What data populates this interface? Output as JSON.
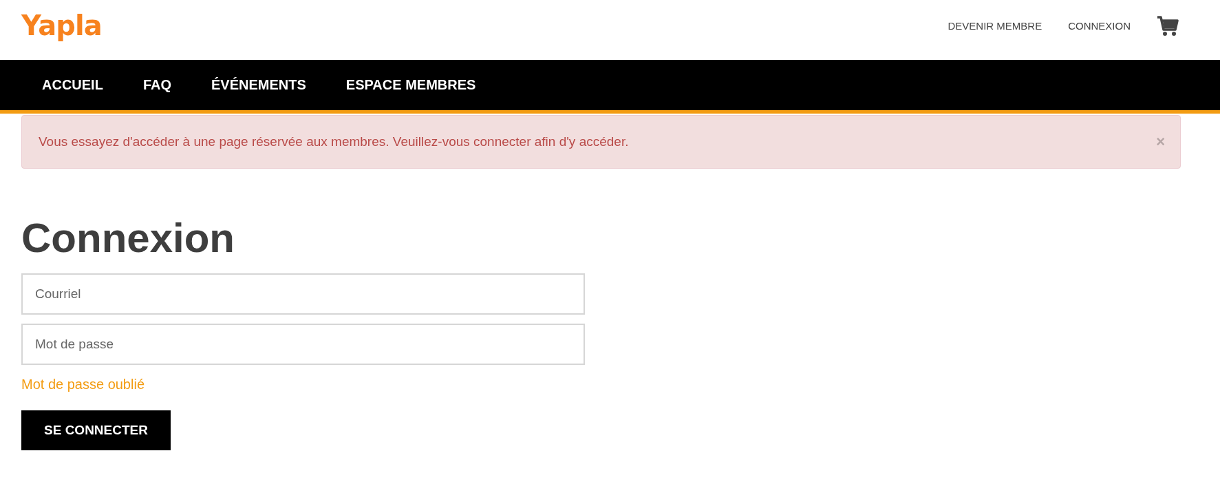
{
  "logo": "Yapla",
  "top_links": [
    "DEVENIR MEMBRE",
    "CONNEXION"
  ],
  "nav": [
    {
      "label": "ACCUEIL"
    },
    {
      "label": "FAQ"
    },
    {
      "label": "ÉVÉNEMENTS"
    },
    {
      "label": "ESPACE MEMBRES"
    }
  ],
  "alert": {
    "message": "Vous essayez d'accéder à une page réservée aux membres. Veuillez-vous connecter afin d'y accéder.",
    "close": "×"
  },
  "login": {
    "title": "Connexion",
    "email": {
      "placeholder": "Courriel"
    },
    "password": {
      "placeholder": "Mot de passe"
    },
    "forgot": "Mot de passe oublié",
    "submit": "SE CONNECTER"
  }
}
